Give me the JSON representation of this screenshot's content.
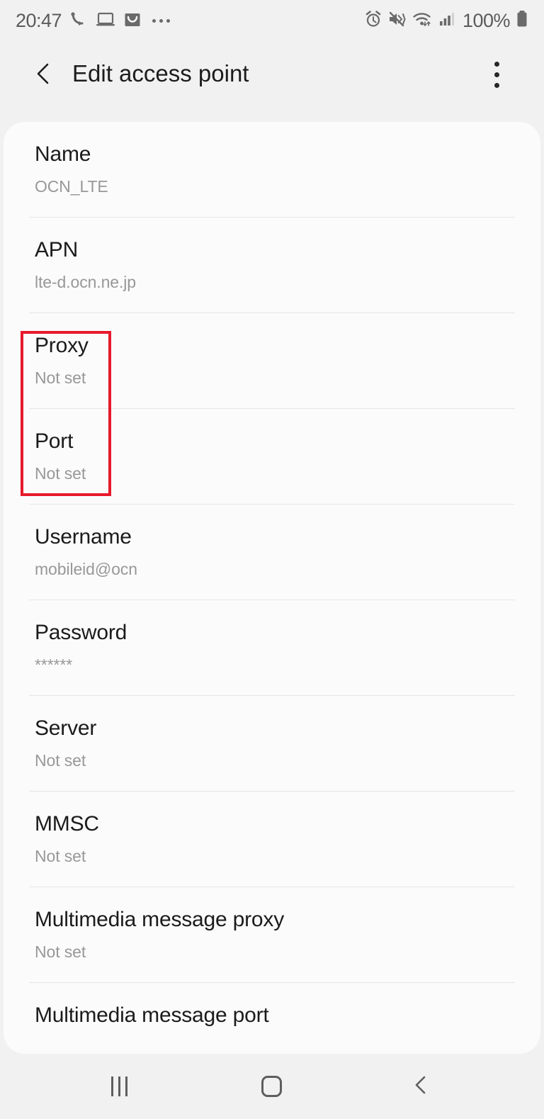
{
  "status_bar": {
    "time": "20:47",
    "battery_percent": "100%",
    "left_icons": [
      "call-forwarding-icon",
      "laptop-icon",
      "shopping-bag-icon",
      "more-notifications-icon"
    ],
    "right_icons": [
      "alarm-icon",
      "mute-vibrate-icon",
      "wifi-icon",
      "signal-bars-icon",
      "battery-icon"
    ]
  },
  "appbar": {
    "back_label": "back-chevron",
    "title": "Edit access point",
    "overflow_label": "more-options"
  },
  "settings": {
    "rows": [
      {
        "title": "Name",
        "value": "OCN_LTE"
      },
      {
        "title": "APN",
        "value": "lte-d.ocn.ne.jp"
      },
      {
        "title": "Proxy",
        "value": "Not set"
      },
      {
        "title": "Port",
        "value": "Not set"
      },
      {
        "title": "Username",
        "value": "mobileid@ocn"
      },
      {
        "title": "Password",
        "value": "******"
      },
      {
        "title": "Server",
        "value": "Not set"
      },
      {
        "title": "MMSC",
        "value": "Not set"
      },
      {
        "title": "Multimedia message proxy",
        "value": "Not set"
      },
      {
        "title": "Multimedia message port",
        "value": ""
      }
    ]
  },
  "annotation": {
    "color": "#e8192c",
    "targets": [
      "Proxy",
      "Port"
    ]
  },
  "navbar": {
    "recents_label": "recent-apps",
    "home_label": "home",
    "back_label": "back"
  }
}
